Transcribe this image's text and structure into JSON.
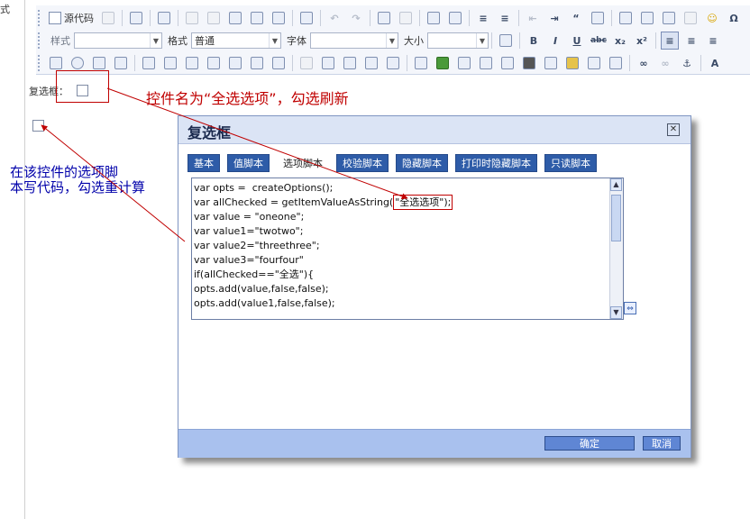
{
  "gutter_char": "式",
  "toolbar": {
    "source_label": "源代码",
    "style_label": "样式",
    "style_value": "",
    "format_label": "格式",
    "format_value": "普通",
    "font_label": "字体",
    "font_value": "",
    "size_label": "大小",
    "size_value": "",
    "bold": "B",
    "italic": "I",
    "underline": "U",
    "strike": "abc",
    "subscript": "x₂",
    "superscript": "x²",
    "omega": "Ω",
    "anchor": "⚓"
  },
  "canvas": {
    "checkbox_label": "复选框："
  },
  "annotations": {
    "top_note": "控件名为“全选选项”，勾选刷新",
    "left_note_line1": "在该控件的选项脚",
    "left_note_line2": "本写代码，勾选重计算",
    "accent_color": "#c00000",
    "note_color": "#0000aa"
  },
  "dialog": {
    "title": "复选框",
    "tabs": [
      "基本",
      "值脚本",
      "选项脚本",
      "校验脚本",
      "隐藏脚本",
      "打印时隐藏脚本",
      "只读脚本"
    ],
    "active_tab": "选项脚本",
    "code_lines": [
      "var opts =  createOptions();",
      "var allChecked = getItemValueAsString(",
      "var value = \"oneone\";",
      "var value1=\"twotwo\";",
      "var value2=\"threethree\";",
      "var value3=\"fourfour\"",
      "if(allChecked==\"全选\"){",
      "opts.add(value,false,false);",
      "opts.add(value1,false,false);"
    ],
    "highlighted_arg": "\"全选选项\");",
    "ok_label": "确定",
    "cancel_label": "取消"
  }
}
